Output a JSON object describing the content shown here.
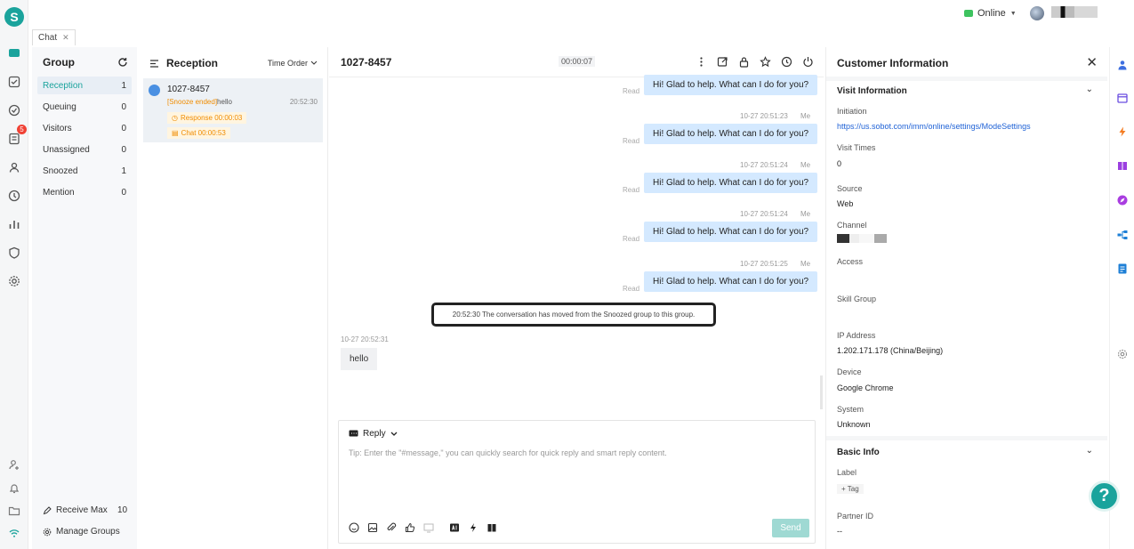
{
  "app": {
    "logo_letter": "S",
    "brand_color": "#1aa39c"
  },
  "topbar": {
    "status_label": "Online",
    "status_color": "#3ec35f"
  },
  "tabs": [
    {
      "label": "Chat"
    }
  ],
  "rail": {
    "badge": "5"
  },
  "group_panel": {
    "title": "Group",
    "items": [
      {
        "label": "Reception",
        "count": "1",
        "active": true
      },
      {
        "label": "Queuing",
        "count": "0"
      },
      {
        "label": "Visitors",
        "count": "0"
      },
      {
        "label": "Unassigned",
        "count": "0"
      },
      {
        "label": "Snoozed",
        "count": "1"
      },
      {
        "label": "Mention",
        "count": "0"
      }
    ],
    "receive_max_label": "Receive Max",
    "receive_max_value": "10",
    "manage_groups_label": "Manage Groups"
  },
  "reception": {
    "title": "Reception",
    "sort_label": "Time Order",
    "conversation": {
      "id": "1027-8457",
      "last_tag": "[Snooze ended]",
      "last_text": "hello",
      "time": "20:52:30",
      "response_label": "Response 00:00:03",
      "chat_label": "Chat 00:00:53"
    }
  },
  "chat": {
    "title": "1027-8457",
    "timer": "00:00:07",
    "messages": [
      {
        "text": "Hi! Glad to help. What can I do for you?",
        "read": "Read",
        "stamp": ""
      },
      {
        "text": "Hi! Glad to help. What can I do for you?",
        "read": "Read",
        "stamp": "10-27 20:51:23",
        "sender": "Me"
      },
      {
        "text": "Hi! Glad to help. What can I do for you?",
        "read": "Read",
        "stamp": "10-27 20:51:24",
        "sender": "Me"
      },
      {
        "text": "Hi! Glad to help. What can I do for you?",
        "read": "Read",
        "stamp": "10-27 20:51:24",
        "sender": "Me"
      },
      {
        "text": "Hi! Glad to help. What can I do for you?",
        "read": "Read",
        "stamp": "10-27 20:51:25",
        "sender": "Me"
      }
    ],
    "system_note": "20:52:30 The conversation has moved from the Snoozed group to this group.",
    "incoming_stamp": "10-27 20:52:31",
    "incoming_text": "hello",
    "composer": {
      "mode": "Reply",
      "placeholder": "Tip: Enter the \"#message,\" you can quickly search for quick reply and smart reply content.",
      "send_label": "Send"
    }
  },
  "customer": {
    "title": "Customer Information",
    "visit_section": "Visit Information",
    "fields": {
      "initiation_label": "Initiation",
      "initiation_value": "https://us.sobot.com/imm/online/settings/ModeSettings",
      "visit_times_label": "Visit Times",
      "visit_times_value": "0",
      "source_label": "Source",
      "source_value": "Web",
      "channel_label": "Channel",
      "access_label": "Access",
      "skill_group_label": "Skill Group",
      "ip_label": "IP Address",
      "ip_value": "1.202.171.178 (China/Beijing)",
      "device_label": "Device",
      "device_value": "Google Chrome",
      "system_label": "System",
      "system_value": "Unknown"
    },
    "basic_section": "Basic Info",
    "label_label": "Label",
    "tag_button": "+ Tag",
    "partner_label": "Partner ID",
    "partner_value": "--"
  },
  "help": {
    "glyph": "?"
  }
}
